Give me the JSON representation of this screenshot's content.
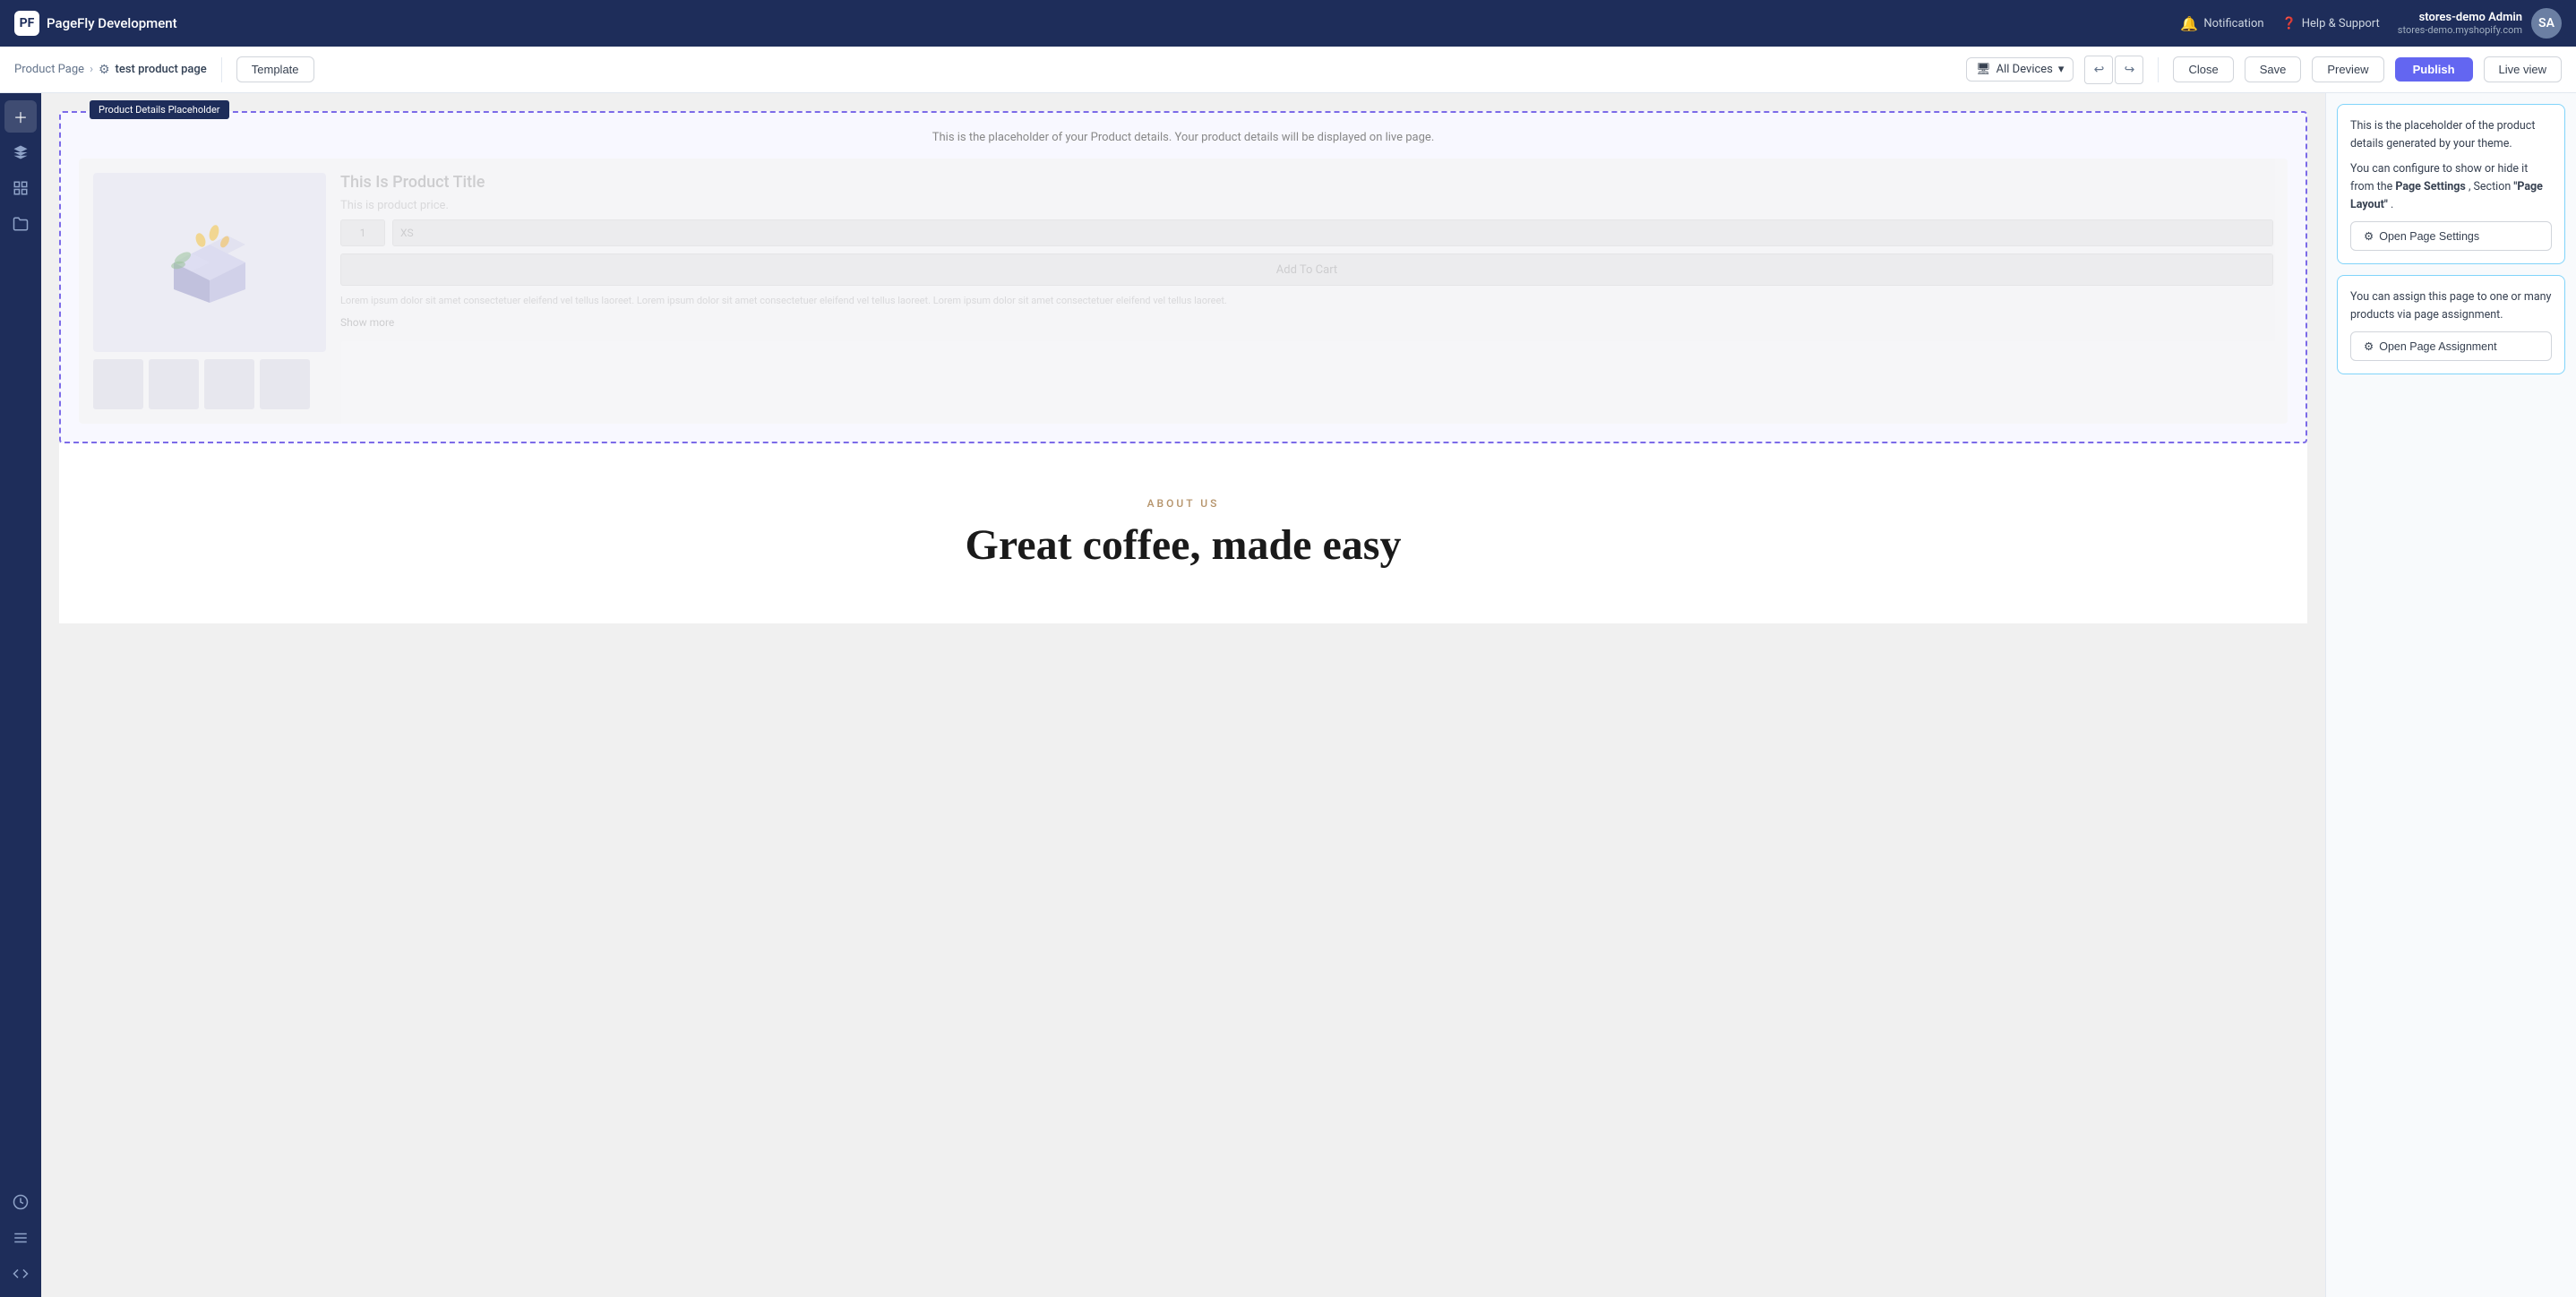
{
  "app": {
    "name": "PageFly Development"
  },
  "topnav": {
    "notification_label": "Notification",
    "help_label": "Help & Support",
    "user_name": "stores-demo Admin",
    "user_domain": "stores-demo.myshopify.com"
  },
  "toolbar": {
    "breadcrumb_root": "Product Page",
    "breadcrumb_page": "test product page",
    "template_label": "Template",
    "devices_label": "All Devices",
    "close_label": "Close",
    "save_label": "Save",
    "preview_label": "Preview",
    "publish_label": "Publish",
    "live_view_label": "Live view"
  },
  "canvas": {
    "element_label": "Product Details Placeholder",
    "placeholder_description": "This is the placeholder of your Product details. Your product details will be displayed on live page.",
    "product_title_fake": "This Is Product Title",
    "product_price_fake": "This is product price.",
    "qty_value": "1",
    "variant_value": "XS",
    "add_to_cart_label": "Add To Cart",
    "lorem_text": "Lorem ipsum dolor sit amet consectetuer eleifend vel tellus laoreet. Lorem ipsum dolor sit amet consectetuer eleifend vel tellus laoreet. Lorem ipsum dolor sit amet consectetuer eleifend vel tellus laoreet.",
    "show_more_label": "Show more",
    "about_subtitle": "ABOUT US",
    "about_title": "Great coffee, made easy"
  },
  "right_panel": {
    "card1_text1": "This is the placeholder of the product details generated by your theme.",
    "card1_text2": "You can configure to show or hide it from the ",
    "card1_bold1": "Page Settings",
    "card1_text3": ", Section ",
    "card1_bold2": "\"Page Layout\"",
    "card1_text4": ".",
    "open_page_settings_label": "Open Page Settings",
    "card2_text": "You can assign this page to one or many products via page assignment.",
    "open_page_assignment_label": "Open Page Assignment"
  },
  "sidebar": {
    "items": [
      {
        "icon": "＋",
        "name": "add-element-icon",
        "label": "Add element"
      },
      {
        "icon": "⊞",
        "name": "layers-icon",
        "label": "Layers"
      },
      {
        "icon": "⊟",
        "name": "elements-icon",
        "label": "Elements"
      },
      {
        "icon": "📁",
        "name": "pages-icon",
        "label": "Pages"
      }
    ],
    "bottom_items": [
      {
        "icon": "🕐",
        "name": "history-icon",
        "label": "History"
      },
      {
        "icon": "☰",
        "name": "list-icon",
        "label": "List"
      },
      {
        "icon": "⟨/⟩",
        "name": "code-icon",
        "label": "Code"
      }
    ]
  }
}
